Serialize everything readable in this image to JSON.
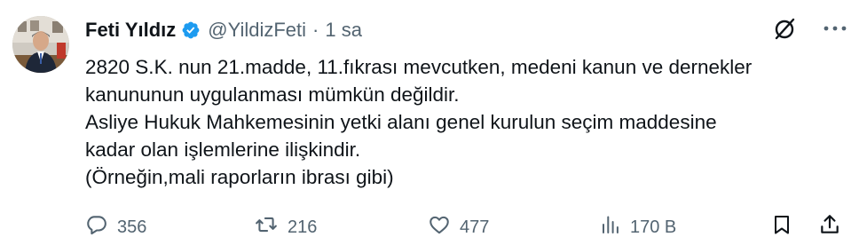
{
  "tweet": {
    "author_name": "Feti Yıldız",
    "handle": "@YildizFeti",
    "separator": "·",
    "time": "1 sa",
    "lines": [
      "2820 S.K. nun 21.madde, 11.fıkrası mevcutken, medeni kanun ve dernekler",
      "kanununun uygulanması mümkün değildir.",
      "Asliye Hukuk Mahkemesinin yetki alanı genel kurulun seçim maddesine",
      "kadar olan işlemlerine ilişkindir.",
      "(Örneğin,mali raporların ibrası gibi)"
    ]
  },
  "stats": {
    "replies": "356",
    "retweets": "216",
    "likes": "477",
    "views": "170 B"
  },
  "icons": {
    "verified": "verified-badge-icon",
    "grok": "grok-icon",
    "more": "more-icon",
    "reply": "reply-icon",
    "retweet": "retweet-icon",
    "like": "like-icon",
    "views": "views-icon",
    "bookmark": "bookmark-icon",
    "share": "share-icon"
  },
  "colors": {
    "text": "#0f1419",
    "muted": "#536471",
    "verified": "#1d9bf0"
  }
}
